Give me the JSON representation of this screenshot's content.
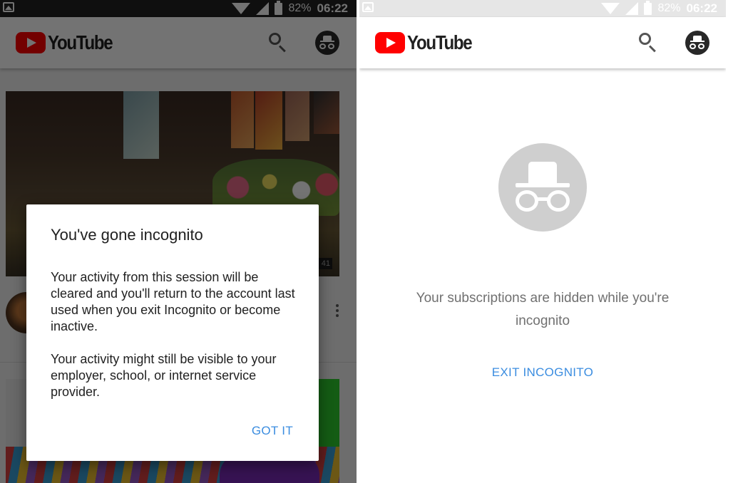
{
  "status_bar": {
    "battery_percent": "82%",
    "time": "06:22"
  },
  "app": {
    "name": "YouTube",
    "brand_color": "#ff0000",
    "accent_color": "#3b8de0"
  },
  "header": {
    "search_icon": "search-icon",
    "account_icon": "incognito-icon"
  },
  "left_screen": {
    "video_badge": "41",
    "dialog": {
      "title": "You've gone incognito",
      "body_1": "Your activity from this session will be cleared and you'll return to the account last used when you exit Incognito or become inactive.",
      "body_2": "Your activity might still be visible to your employer, school, or internet service provider.",
      "button_label": "GOT IT"
    }
  },
  "right_screen": {
    "message": "Your subscriptions are hidden while you're incognito",
    "exit_label": "EXIT INCOGNITO"
  }
}
